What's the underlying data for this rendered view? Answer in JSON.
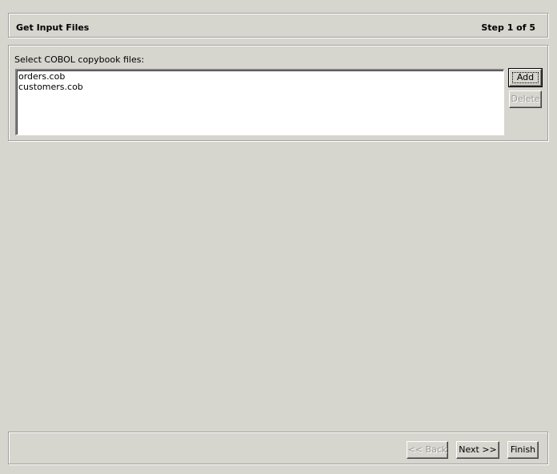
{
  "header": {
    "title": "Get Input Files",
    "step": "Step 1 of 5"
  },
  "content": {
    "files_label": "Select COBOL copybook files:",
    "files": [
      "orders.cob",
      "customers.cob"
    ],
    "add_label": "Add",
    "delete_label": "Delete"
  },
  "footer": {
    "back_label": "<< Back",
    "next_label": "Next >>",
    "finish_label": "Finish"
  }
}
